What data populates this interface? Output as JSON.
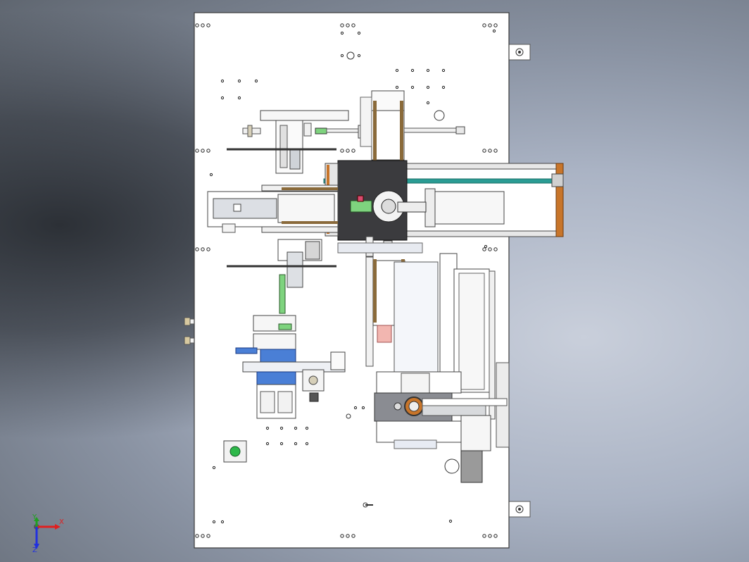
{
  "viewport": {
    "background_colors": [
      "#2c3036",
      "#8a93a3",
      "#c9cfdb"
    ]
  },
  "colors": {
    "plate": "#ffffff",
    "plate_edge": "#3a3a3a",
    "dark_block": "#3b3b3e",
    "teal_belt": "#2a9c94",
    "orange_frame": "#c8752a",
    "green_part": "#7ed37e",
    "blue_part": "#4a7fd6",
    "pink_part": "#f2b6b0",
    "bronze_rail": "#8a6a3a"
  },
  "triad": {
    "x_label": "X",
    "y_label": "Y",
    "z_label": "Z",
    "x_color": "#e02020",
    "y_color": "#20a020",
    "z_color": "#2030e0"
  }
}
